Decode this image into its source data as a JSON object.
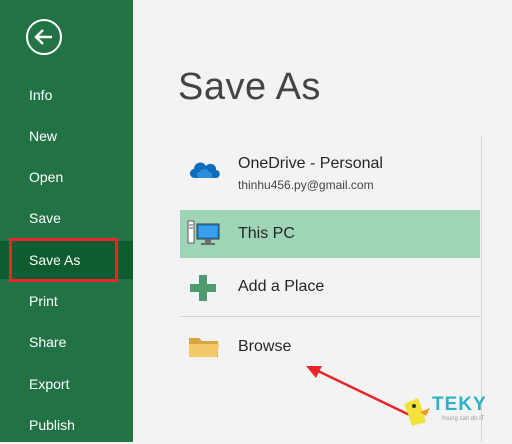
{
  "sidebar": {
    "back_icon": "back-arrow-icon",
    "items": [
      {
        "label": "Info"
      },
      {
        "label": "New"
      },
      {
        "label": "Open"
      },
      {
        "label": "Save"
      },
      {
        "label": "Save As",
        "active": true
      },
      {
        "label": "Print"
      },
      {
        "label": "Share"
      },
      {
        "label": "Export"
      },
      {
        "label": "Publish"
      }
    ]
  },
  "main": {
    "title": "Save As",
    "locations": [
      {
        "label": "OneDrive - Personal",
        "sublabel": "thinhu456.py@gmail.com",
        "icon": "onedrive-cloud-icon"
      },
      {
        "label": "This PC",
        "icon": "computer-icon",
        "selected": true
      },
      {
        "label": "Add a Place",
        "icon": "plus-icon"
      },
      {
        "label": "Browse",
        "icon": "folder-icon"
      }
    ]
  },
  "watermark": {
    "brand": "TEKY",
    "tagline": "Young can do IT"
  },
  "colors": {
    "sidebar": "#217346",
    "selected_bg": "#9fd5b7",
    "highlight": "#e8262a",
    "brand": "#2cb2c6"
  }
}
